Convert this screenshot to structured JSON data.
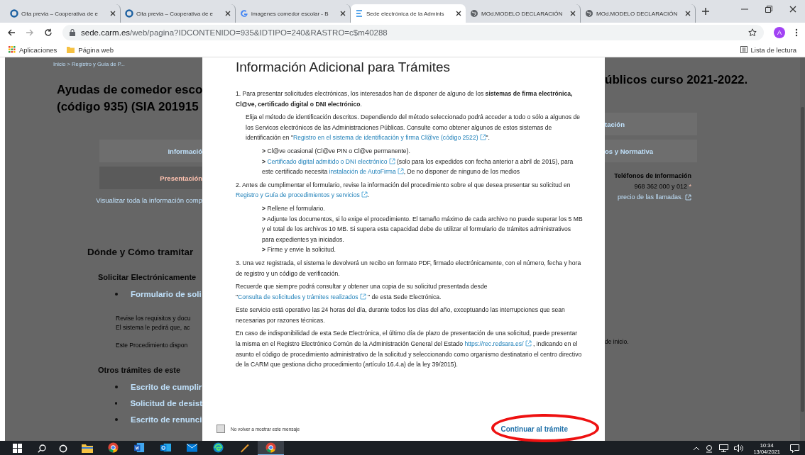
{
  "browser": {
    "tabs": [
      {
        "title": "Cita previa – Cooperativa de e",
        "selected": false
      },
      {
        "title": "Cita previa – Cooperativa de e",
        "selected": false
      },
      {
        "title": "imagenes comedor escolar - B",
        "selected": false
      },
      {
        "title": "Sede electrónica de la Adminis",
        "selected": true
      },
      {
        "title": "MOd.MODELO DECLARACIÓN",
        "selected": false
      },
      {
        "title": "MOd.MODELO DECLARACIÓN",
        "selected": false
      }
    ],
    "url_host": "sede.carm.es",
    "url_path": "/web/pagina?IDCONTENIDO=935&IDTIPO=240&RASTRO=c$m40288",
    "profile_initial": "A",
    "bookmarks": [
      {
        "label": "Aplicaciones"
      },
      {
        "label": "Página web"
      }
    ],
    "reading_list": "Lista de lectura"
  },
  "background_page": {
    "left": [
      {
        "kind": "breadcrumb",
        "text": "Inicio > Registro y Guía de P..."
      },
      {
        "kind": "title",
        "lines": [
          "Ayudas de comedor esco",
          "(código 935) (SIA 201915"
        ]
      },
      {
        "kind": "tab",
        "text": "Informació",
        "selected": false
      },
      {
        "kind": "tab",
        "text": "Presentación",
        "selected": true
      },
      {
        "kind": "link",
        "text": "Visualizar toda la información comp"
      },
      {
        "kind": "heading",
        "text": "Dónde y Cómo tramitar"
      },
      {
        "kind": "subheading",
        "text": "Solicitar Electrónicamente"
      },
      {
        "kind": "bullet",
        "text": "Formulario de soli"
      },
      {
        "kind": "text",
        "lines": [
          "Revise los requisitos y docu",
          "El sistema le pedirá que, ac"
        ]
      },
      {
        "kind": "text",
        "lines": [
          "Este Procedimiento dispon"
        ]
      },
      {
        "kind": "subheading",
        "text": "Otros trámites de este"
      },
      {
        "kind": "bullet",
        "text": "Escrito de cumplir"
      },
      {
        "kind": "bullet",
        "text": "Solicitud de desist"
      },
      {
        "kind": "bullet",
        "text": "Escrito de renunci"
      }
    ],
    "right": [
      {
        "kind": "title",
        "lines": [
          "úblicos curso 2021-2022."
        ]
      },
      {
        "kind": "tab",
        "text": "tación",
        "selected": false
      },
      {
        "kind": "tab",
        "text": "os y Normativa",
        "selected": false
      },
      {
        "kind": "phones",
        "label": "Teléfonos de Información",
        "number": "968 362 000 y 012",
        "mark": "*",
        "link": "precio de las llamadas."
      },
      {
        "kind": "text",
        "lines": [
          "de inicio."
        ]
      }
    ]
  },
  "modal": {
    "title": "Información Adicional para Trámites",
    "paragraphs": [
      {
        "kind": "paragraph",
        "parts": [
          {
            "kind": "text",
            "text": "1. Para presentar solicitudes electrónicas, los interesados han de disponer de alguno de los **sistemas de firma electrónica, Cl@ve, certificado digital o DNI electrónico**."
          }
        ]
      },
      {
        "kind": "note",
        "parts": [
          {
            "kind": "text",
            "text": "Elija el método de identificación descritos. Dependiendo del método seleccionado podrá acceder a todo o sólo a algunos de los Servicos electrónicos de las Administraciones Públicas. Consulte como obtener algunos de estos sistemas de identificación en \""
          },
          {
            "kind": "link",
            "text": "Registro en el sistema de identificación y firma Cl@ve (código 2522)",
            "external": true
          },
          {
            "kind": "text",
            "text": "\"."
          }
        ]
      },
      {
        "kind": "bullet",
        "parts": [
          {
            "kind": "text",
            "text": "**>** Cl@ve ocasional (Cl@ve PIN o Cl@ve permanente)."
          }
        ]
      },
      {
        "kind": "bullet",
        "parts": [
          {
            "kind": "text",
            "text": "**>** "
          },
          {
            "kind": "link",
            "text": "Certificado digital admitido o DNI electrónico",
            "external": true
          },
          {
            "kind": "text",
            "text": " (solo para los expedidos con fecha anterior a abril de 2015), para este certificado necesita "
          },
          {
            "kind": "link",
            "text": "instalación de AutoFirma",
            "external": true
          },
          {
            "kind": "text",
            "text": ", De no disponer de ninguno de los medios"
          }
        ]
      },
      {
        "kind": "paragraph",
        "parts": [
          {
            "kind": "text",
            "text": "2. Antes de cumplimentar el formulario, revise la información del procedimiento sobre el que desea presentar su solicitud en "
          },
          {
            "kind": "link",
            "text": "Registro y Guía de procedimientos y servicios",
            "external": true
          },
          {
            "kind": "text",
            "text": "."
          }
        ]
      },
      {
        "kind": "bullet",
        "parts": [
          {
            "kind": "text",
            "text": "**>** Rellene el formulario."
          }
        ]
      },
      {
        "kind": "bullet",
        "parts": [
          {
            "kind": "text",
            "text": "**>** Adjunte los documentos, si lo exige el procedimiento. El tamaño máximo de cada archivo no puede superar los 5 MB y el total de los archivos 10 MB. Si supera esta capacidad debe de utilizar el formulario de trámites administrativos para expedientes ya iniciados."
          }
        ]
      },
      {
        "kind": "bullet",
        "parts": [
          {
            "kind": "text",
            "text": "**>** Firme y envie la solicitud."
          }
        ]
      },
      {
        "kind": "paragraph",
        "parts": [
          {
            "kind": "text",
            "text": "3. Una vez registrada, el sistema le devolverá un recibo en formato PDF, firmado electrónicamente, con el número, fecha y hora de registro y un código de verificación."
          }
        ]
      },
      {
        "kind": "paragraph",
        "parts": [
          {
            "kind": "text",
            "text": "Recuerde que siempre podrá consultar y obtener una copia de su solicitud presentada desde \""
          },
          {
            "kind": "link",
            "text": "Consulta de solicitudes y trámites realizados",
            "external": true
          },
          {
            "kind": "text",
            "text": " \" de esta Sede Electrónica."
          }
        ]
      },
      {
        "kind": "paragraph",
        "parts": [
          {
            "kind": "text",
            "text": "Este servicio está operativo las 24 horas del día, durante todos los días del año, exceptuando las interrupciones que sean necesarias por razones técnicas."
          }
        ]
      },
      {
        "kind": "paragraph",
        "parts": [
          {
            "kind": "text",
            "text": "En caso de indisponibilidad de esta Sede Electrónica, el último día de plazo de presentación de una solicitud, puede presentar la misma en el Registro Electrónico Común de la Administración General del Estado "
          },
          {
            "kind": "link",
            "text": "https://rec.redsara.es/",
            "external": true
          },
          {
            "kind": "text",
            "text": " , indicando en el asunto el código de procedimiento administrativo de la solicitud y seleccionando como organismo destinatario el centro directivo de la CARM que gestiona dicho procedimiento (artículo 16.4.a) de la ley 39/2015)."
          }
        ]
      }
    ],
    "dont_show_again": {
      "label": "No volver a mostrar este mensaje",
      "checked": false
    },
    "continue_button": {
      "label": "Continuar al trámite",
      "highlighted": true
    }
  },
  "taskbar": {
    "apps": [
      {
        "kind": "folder",
        "active": false
      },
      {
        "kind": "chrome",
        "active": false
      },
      {
        "kind": "word",
        "active": false
      },
      {
        "kind": "outlook",
        "active": false
      },
      {
        "kind": "mail",
        "active": false
      },
      {
        "kind": "edge",
        "active": false
      },
      {
        "kind": "pen",
        "active": false
      },
      {
        "kind": "chrome",
        "active": true
      }
    ],
    "time": "10:34",
    "date": "13/04/2021"
  }
}
